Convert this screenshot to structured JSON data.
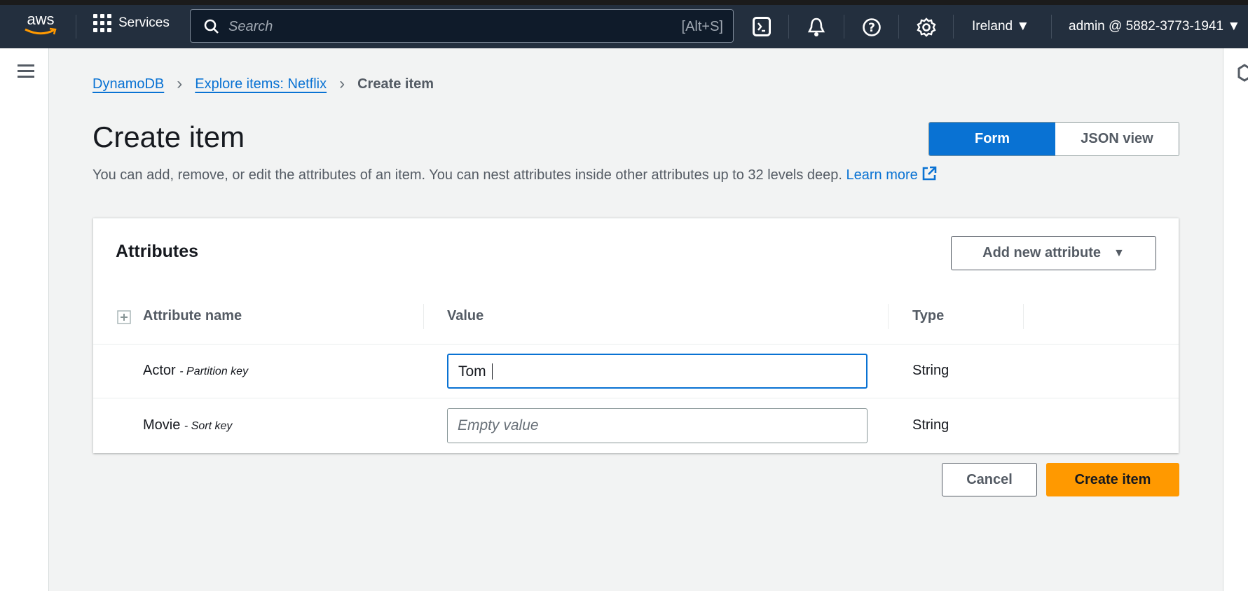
{
  "nav": {
    "logo": "aws",
    "services": "Services",
    "search_placeholder": "Search",
    "search_shortcut": "[Alt+S]",
    "region": "Ireland",
    "account": "admin @ 5882-3773-1941"
  },
  "breadcrumb": [
    "DynamoDB",
    "Explore items: Netflix",
    "Create item"
  ],
  "page": {
    "title": "Create item",
    "description": "You can add, remove, or edit the attributes of an item. You can nest attributes inside other attributes up to 32 levels deep.",
    "learn_more": "Learn more",
    "view_toggle": {
      "form": "Form",
      "json": "JSON view",
      "selected": "Form"
    }
  },
  "attributes": {
    "heading": "Attributes",
    "add_button": "Add new attribute",
    "columns": [
      "Attribute name",
      "Value",
      "Type"
    ],
    "rows": [
      {
        "name": "Actor",
        "key": "- Partition key",
        "value": "Tom",
        "placeholder": "Empty value",
        "type": "String"
      },
      {
        "name": "Movie",
        "key": "- Sort key",
        "value": "",
        "placeholder": "Empty value",
        "type": "String"
      }
    ]
  },
  "actions": {
    "cancel": "Cancel",
    "create": "Create item"
  },
  "colors": {
    "nav": "#232f3e",
    "link": "#0972d3",
    "primary": "#ff9900",
    "selected": "#0972d3"
  }
}
